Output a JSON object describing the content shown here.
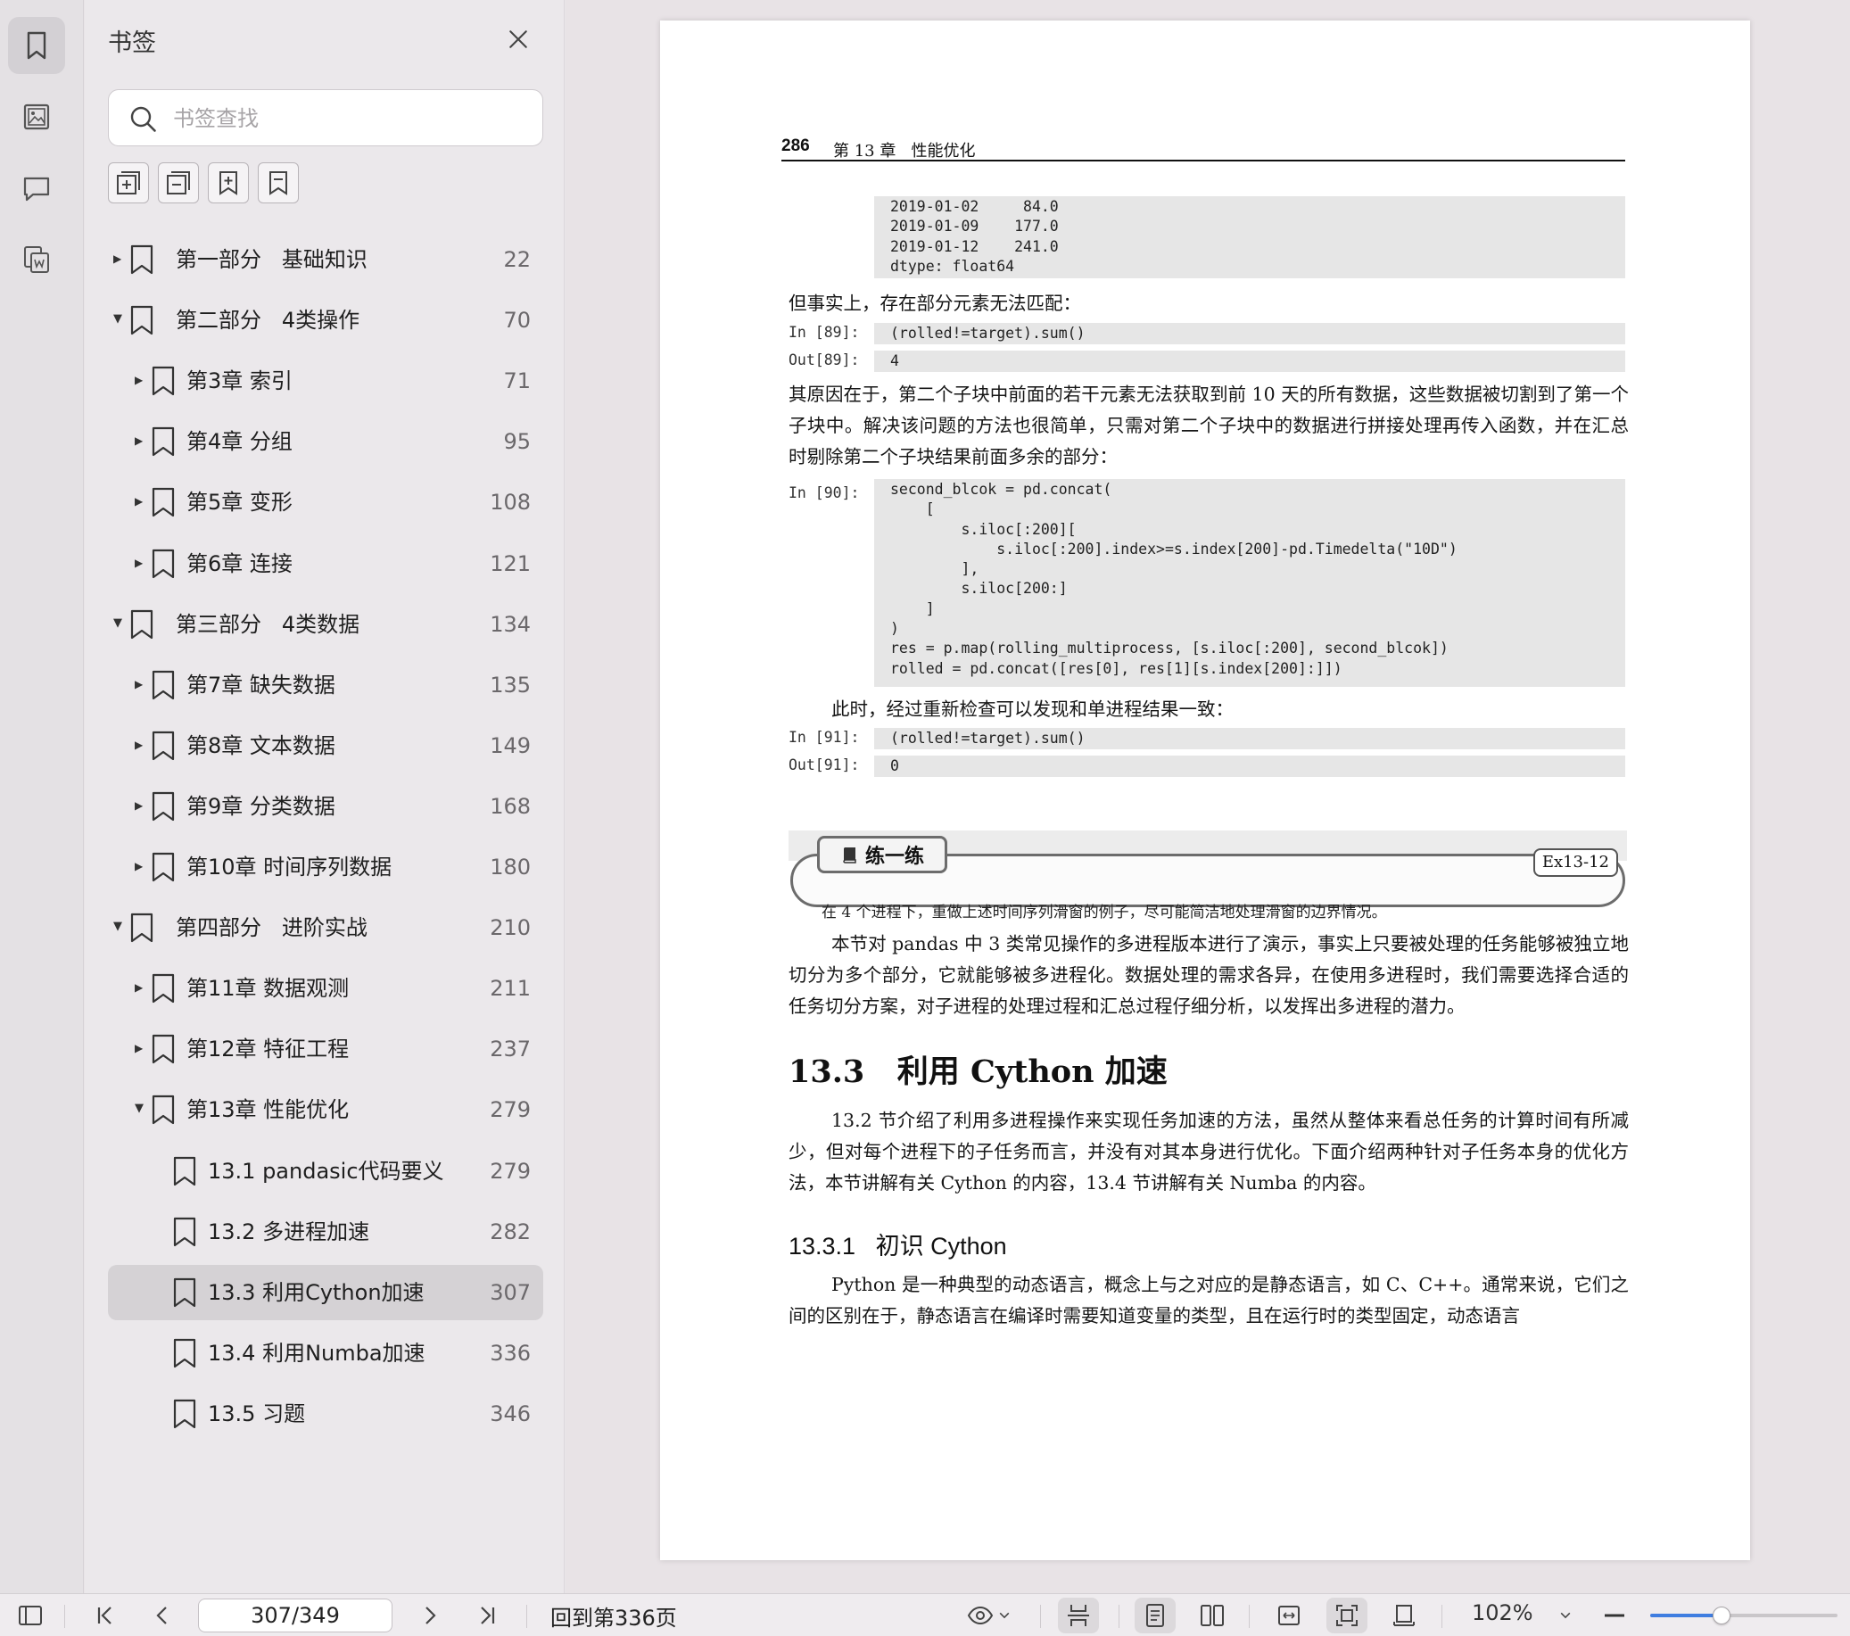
{
  "sidebar_rail": {
    "icons": [
      "bookmark-icon",
      "thumbnail-image-icon",
      "comment-icon",
      "extract-text-icon"
    ]
  },
  "bookmark_panel": {
    "title": "书签",
    "search_placeholder": "书签查找",
    "toolbar_icons": [
      "expand-all-icon",
      "collapse-all-icon",
      "add-bookmark-icon",
      "bookmark-marker-icon"
    ],
    "items": [
      {
        "label": "第一部分   基础知识",
        "page": "22",
        "level": 0,
        "expanded": false,
        "has_children": true
      },
      {
        "label": "第二部分   4类操作",
        "page": "70",
        "level": 0,
        "expanded": true,
        "has_children": true
      },
      {
        "label": "第3章 索引",
        "page": "71",
        "level": 1,
        "expanded": false,
        "has_children": true
      },
      {
        "label": "第4章 分组",
        "page": "95",
        "level": 1,
        "expanded": false,
        "has_children": true
      },
      {
        "label": "第5章 变形",
        "page": "108",
        "level": 1,
        "expanded": false,
        "has_children": true
      },
      {
        "label": "第6章 连接",
        "page": "121",
        "level": 1,
        "expanded": false,
        "has_children": true
      },
      {
        "label": "第三部分   4类数据",
        "page": "134",
        "level": 0,
        "expanded": true,
        "has_children": true
      },
      {
        "label": "第7章 缺失数据",
        "page": "135",
        "level": 1,
        "expanded": false,
        "has_children": true
      },
      {
        "label": "第8章 文本数据",
        "page": "149",
        "level": 1,
        "expanded": false,
        "has_children": true
      },
      {
        "label": "第9章 分类数据",
        "page": "168",
        "level": 1,
        "expanded": false,
        "has_children": true
      },
      {
        "label": "第10章 时间序列数据",
        "page": "180",
        "level": 1,
        "expanded": false,
        "has_children": true
      },
      {
        "label": "第四部分   进阶实战",
        "page": "210",
        "level": 0,
        "expanded": true,
        "has_children": true
      },
      {
        "label": "第11章 数据观测",
        "page": "211",
        "level": 1,
        "expanded": false,
        "has_children": true
      },
      {
        "label": "第12章 特征工程",
        "page": "237",
        "level": 1,
        "expanded": false,
        "has_children": true
      },
      {
        "label": "第13章 性能优化",
        "page": "279",
        "level": 1,
        "expanded": true,
        "has_children": true
      },
      {
        "label": "13.1 pandasic代码要义",
        "page": "279",
        "level": 2,
        "expanded": false,
        "has_children": false
      },
      {
        "label": "13.2 多进程加速",
        "page": "282",
        "level": 2,
        "expanded": false,
        "has_children": false
      },
      {
        "label": "13.3 利用Cython加速",
        "page": "307",
        "level": 2,
        "expanded": false,
        "has_children": false,
        "selected": true
      },
      {
        "label": "13.4 利用Numba加速",
        "page": "336",
        "level": 2,
        "expanded": false,
        "has_children": false
      },
      {
        "label": "13.5 习题",
        "page": "346",
        "level": 2,
        "expanded": false,
        "has_children": false
      }
    ]
  },
  "document": {
    "header_page_number": "286",
    "header_chapter": "第 13 章   性能优化",
    "code_output_1": "2019-01-02     84.0\n2019-01-09    177.0\n2019-01-12    241.0\ndtype: float64",
    "para_1": "但事实上，存在部分元素无法匹配：",
    "in_89": "In [89]:",
    "code_89": "(rolled!=target).sum()",
    "out_89": "Out[89]:",
    "result_89": "4",
    "para_2": "其原因在于，第二个子块中前面的若干元素无法获取到前 10 天的所有数据，这些数据被切割到了第一个子块中。解决该问题的方法也很简单，只需对第二个子块中的数据进行拼接处理再传入函数，并在汇总时剔除第二个子块结果前面多余的部分：",
    "in_90": "In [90]:",
    "code_90": "second_blcok = pd.concat(\n    [\n        s.iloc[:200][\n            s.iloc[:200].index>=s.index[200]-pd.Timedelta(\"10D\")\n        ],\n        s.iloc[200:]\n    ]\n)\nres = p.map(rolling_multiprocess, [s.iloc[:200], second_blcok])\nrolled = pd.concat([res[0], res[1][s.index[200]:]])",
    "para_3": "此时，经过重新检查可以发现和单进程结果一致：",
    "in_91": "In [91]:",
    "code_91": "(rolled!=target).sum()",
    "out_91": "Out[91]:",
    "result_91": "0",
    "exercise_title": "练一练",
    "exercise_id": "Ex13-12",
    "exercise_text": "在 4 个进程下，重做上述时间序列滑窗的例子，尽可能简洁地处理滑窗的边界情况。",
    "para_4": "本节对 pandas 中 3 类常见操作的多进程版本进行了演示，事实上只要被处理的任务能够被独立地切分为多个部分，它就能够被多进程化。数据处理的需求各异，在使用多进程时，我们需要选择合适的任务切分方案，对子进程的处理过程和汇总过程仔细分析，以发挥出多进程的潜力。",
    "section_heading": "13.3   利用 Cython 加速",
    "para_5": "13.2 节介绍了利用多进程操作来实现任务加速的方法，虽然从整体来看总任务的计算时间有所减少，但对每个进程下的子任务而言，并没有对其本身进行优化。下面介绍两种针对子任务本身的优化方法，本节讲解有关 Cython 的内容，13.4 节讲解有关 Numba 的内容。",
    "subsection_heading": "13.3.1   初识 Cython",
    "para_6": "Python 是一种典型的动态语言，概念上与之对应的是静态语言，如 C、C++。通常来说，它们之间的区别在于，静态语言在编译时需要知道变量的类型，且在运行时的类型固定，动态语言"
  },
  "bottom_toolbar": {
    "page_indicator": "307/349",
    "goto_label": "回到第336页",
    "zoom_label": "102%",
    "zoom_slider_fraction": 0.38,
    "accent_color": "#3f7de0"
  }
}
